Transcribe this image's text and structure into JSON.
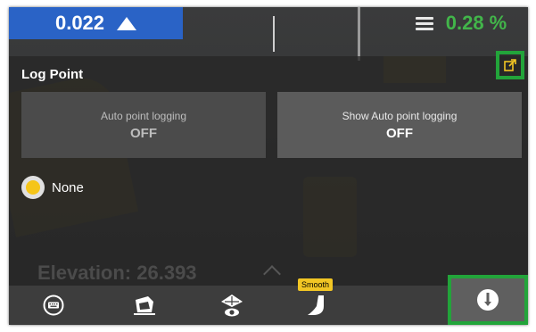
{
  "top": {
    "cut_fill_value": "0.022",
    "cut_fill_direction": "up-triangle-icon",
    "slope_value": "0.28 %",
    "slope_icon": "slope-icon",
    "slope_color": "#42b54a",
    "cut_color": "#2a63c6"
  },
  "panel": {
    "title": "Log Point",
    "popout_icon": "external-link-icon",
    "auto_logging": {
      "label": "Auto point logging",
      "value": "OFF"
    },
    "show_auto_logging": {
      "label": "Show Auto point logging",
      "value": "OFF"
    },
    "point_option": {
      "label": "None",
      "color": "#f5c518"
    }
  },
  "elevation": "Elevation: 26.393",
  "toolbar": {
    "items": [
      {
        "icon": "keyboard-icon"
      },
      {
        "icon": "excavator-bucket-icon"
      },
      {
        "icon": "view-eye-icon"
      },
      {
        "icon": "smooth-bucket-icon",
        "tag": "Smooth"
      },
      {
        "icon": "warning-icon"
      }
    ]
  }
}
